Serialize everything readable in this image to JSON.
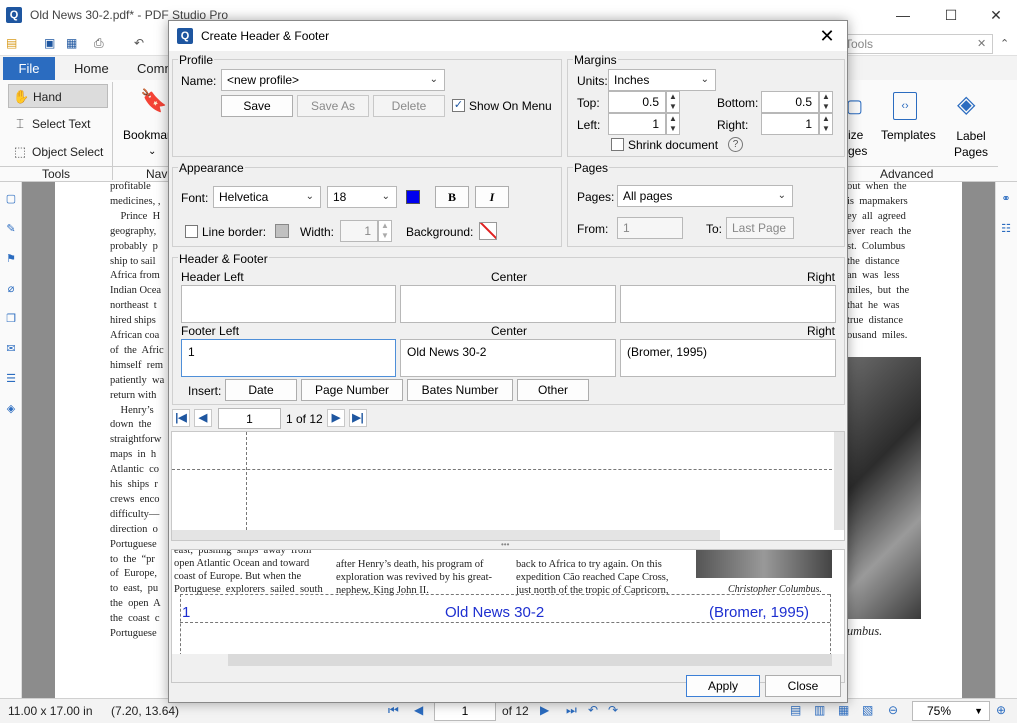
{
  "app": {
    "title": "Old News 30-2.pdf* - PDF Studio Pro",
    "minimize": "—",
    "maximize": "☐",
    "close": "✕"
  },
  "search": {
    "placeholder": "Tools"
  },
  "ribbon": {
    "tabs": [
      "File",
      "Home",
      "Comm"
    ],
    "tools_group": {
      "items": [
        "Hand",
        "Select Text",
        "Object Select"
      ],
      "label": "Tools"
    },
    "nav_group": {
      "bookmark": "Bookmar",
      "label": "Nav"
    },
    "advanced_group": {
      "left_partial": [
        "ize",
        "ges"
      ],
      "templates": "Templates",
      "label_pages": "Label\nPages",
      "label": "Advanced"
    }
  },
  "document": {
    "left_col": [
      "profitable",
      "medicines, ,",
      "    Prince  H",
      "geography,",
      "probably  p",
      "ship to sail",
      "Africa from",
      "Indian Ocea",
      "northeast  t",
      "hired ships",
      "African coa",
      "of  the  Afric",
      "himself  rem",
      "patiently  wa",
      "return with",
      "    Henry’s",
      "down  the",
      "straightforw",
      "maps  in  h",
      "Atlantic  co",
      "his  ships  r",
      "crews  enco",
      "difficulty—",
      "direction  o",
      "Portuguese",
      "to  the  “pr",
      "of  Europe,",
      "to  east,  pu",
      "the  open  A",
      "the  coast  c",
      "Portuguese"
    ],
    "right_col": [
      "out  when  the",
      "is  mapmakers",
      "ey  all  agreed",
      "ever  reach  the",
      "st.  Columbus",
      "the  distance",
      "an  was  less",
      "miles,  but  the",
      "that  he  was",
      "true  distance",
      "ousand  miles."
    ],
    "bottom_caption": "umbus."
  },
  "status": {
    "page_size": "11.00 x 17.00 in",
    "coords": "(7.20, 13.64)",
    "page_input": "1",
    "page_of": "of 12",
    "zoom": "75%"
  },
  "dialog": {
    "title": "Create Header & Footer",
    "profile": {
      "section": "Profile",
      "name_label": "Name:",
      "name_value": "<new profile>",
      "save": "Save",
      "save_as": "Save As",
      "delete": "Delete",
      "show_on_menu": "Show On Menu"
    },
    "margins": {
      "section": "Margins",
      "units_label": "Units:",
      "units_value": "Inches",
      "top_label": "Top:",
      "top": "0.5",
      "bottom_label": "Bottom:",
      "bottom": "0.5",
      "left_label": "Left:",
      "left": "1",
      "right_label": "Right:",
      "right": "1",
      "shrink": "Shrink document",
      "help": "?"
    },
    "appearance": {
      "section": "Appearance",
      "font_label": "Font:",
      "font_value": "Helvetica",
      "size_value": "18",
      "bold": "B",
      "italic": "I",
      "line_border": "Line border:",
      "width_label": "Width:",
      "width_value": "1",
      "background_label": "Background:",
      "text_color": "#0000ee"
    },
    "pages": {
      "section": "Pages",
      "pages_label": "Pages:",
      "pages_value": "All pages",
      "from_label": "From:",
      "from_value": "1",
      "to_label": "To:",
      "to_value": "Last Page"
    },
    "hf": {
      "section": "Header & Footer",
      "header_left": "Header Left",
      "header_center": "Center",
      "header_right": "Right",
      "footer_left": "Footer Left",
      "footer_center": "Center",
      "footer_right": "Right",
      "footer_left_value": "1",
      "footer_center_value": "Old News 30-2",
      "footer_right_value": "(Bromer, 1995)",
      "insert_label": "Insert:",
      "date": "Date",
      "page_number": "Page Number",
      "bates_number": "Bates Number",
      "other": "Other"
    },
    "nav": {
      "page_value": "1",
      "page_of": "1 of 12"
    },
    "preview": {
      "col1": [
        "east,  pushing  ships  away  from",
        "open Atlantic Ocean and toward",
        "coast of Europe. But when the",
        "Portuguese  explorers  sailed  south"
      ],
      "col2": [
        "after Henry’s death, his program of",
        "exploration was revived by his great-",
        "nephew, King John II."
      ],
      "col3": [
        "back to Africa to try again. On this",
        "expedition Cão reached Cape Cross,",
        "just north of the tropic of Capricorn,"
      ],
      "caption": "Christopher Columbus.",
      "footer_left": "1",
      "footer_center": "Old News 30-2",
      "footer_right": "(Bromer, 1995)"
    },
    "apply": "Apply",
    "close": "Close"
  }
}
